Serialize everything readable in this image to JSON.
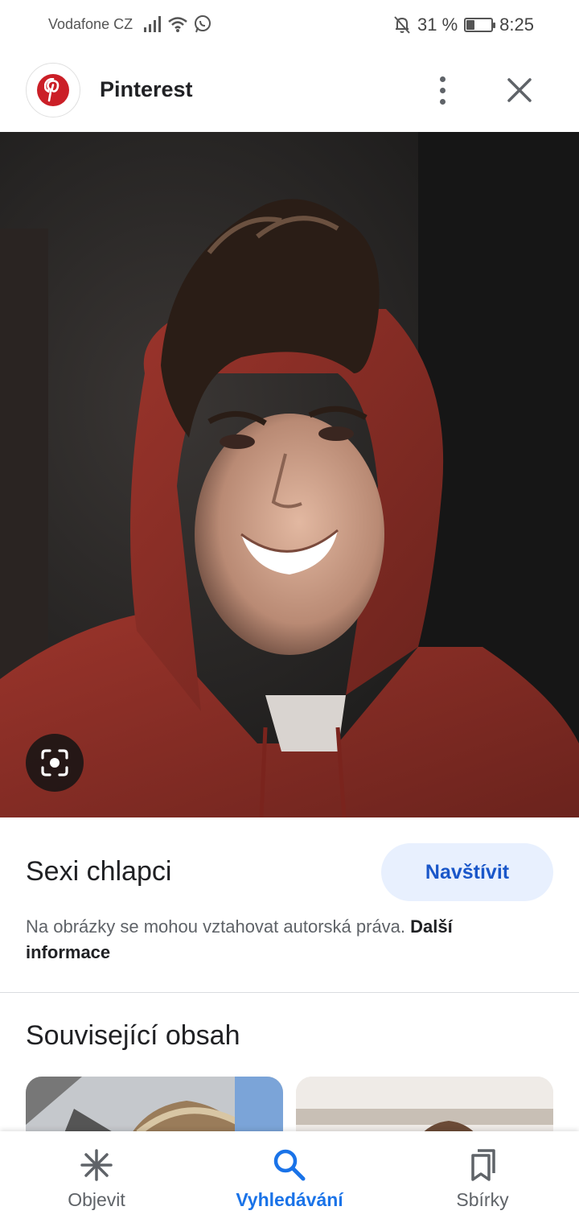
{
  "status_bar": {
    "carrier": "Vodafone CZ",
    "battery_text": "31 %",
    "battery_level": 0.31,
    "time": "8:25",
    "icons": [
      "signal-icon",
      "wifi-icon",
      "whatsapp-icon",
      "mute-bell-icon",
      "battery-icon"
    ]
  },
  "header": {
    "app_name": "Pinterest",
    "logo": "pinterest-logo",
    "more_icon": "more-vert-icon",
    "close_icon": "close-icon"
  },
  "image": {
    "lens_icon": "lens-icon"
  },
  "info": {
    "title": "Sexi chlapci",
    "visit_label": "Navštívit",
    "copyright_text": "Na obrázky se mohou vztahovat autorská práva. ",
    "more_info_label": "Další informace"
  },
  "related": {
    "title": "Související obsah"
  },
  "bottom_nav": {
    "items": [
      {
        "label": "Objevit",
        "icon": "asterisk-icon",
        "active": false
      },
      {
        "label": "Vyhledávání",
        "icon": "search-icon",
        "active": true
      },
      {
        "label": "Sbírky",
        "icon": "bookmarks-icon",
        "active": false
      }
    ]
  },
  "colors": {
    "accent": "#1a73e8",
    "visit_bg": "#e8f0fe",
    "visit_text": "#1a57c9",
    "pinterest_red": "#cb1f27",
    "hoodie_red": "#8e2f27"
  }
}
